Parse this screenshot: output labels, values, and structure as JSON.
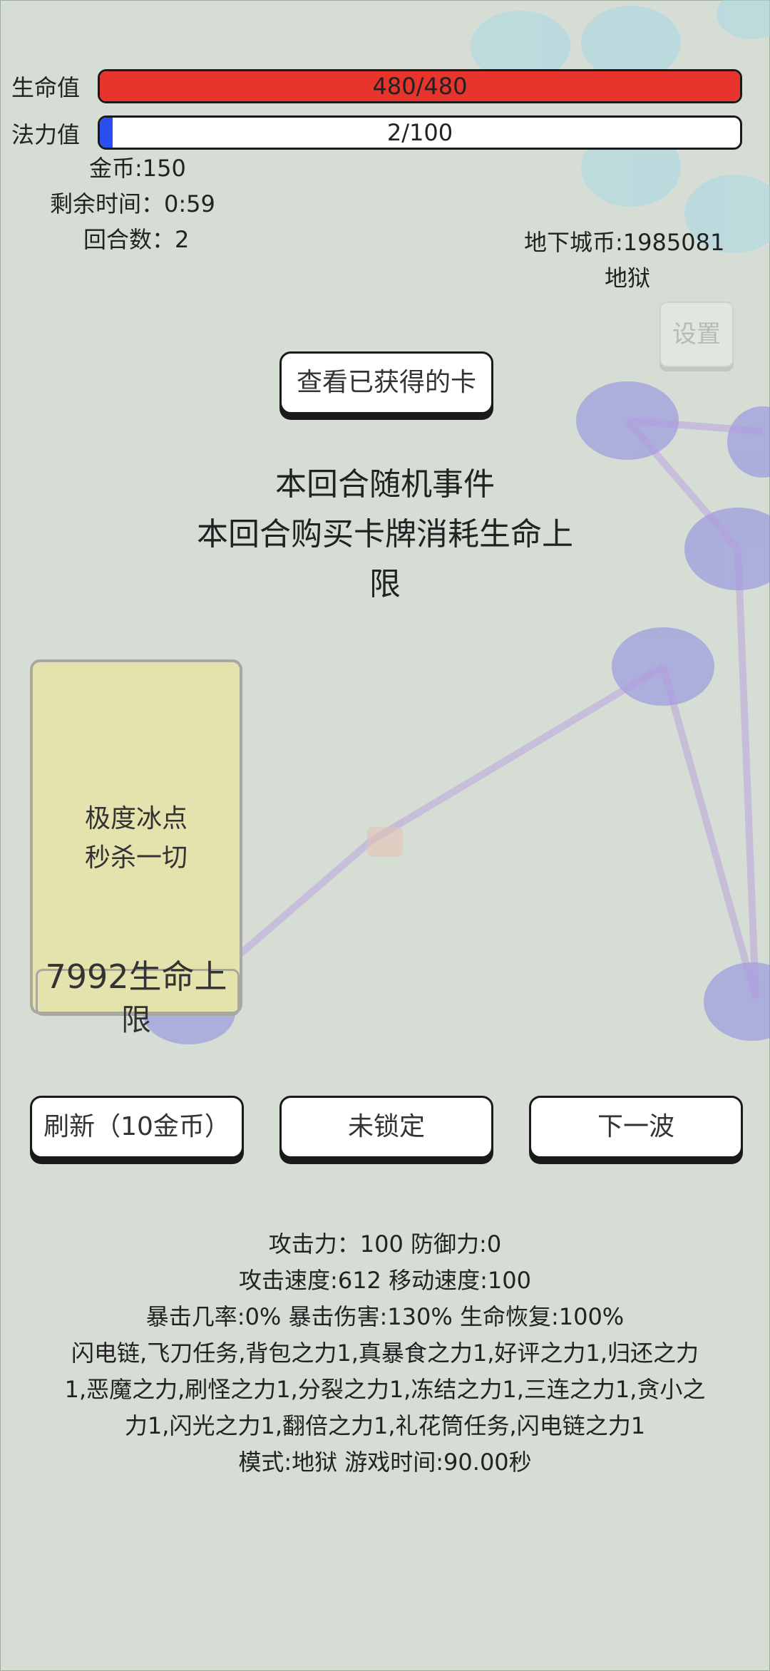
{
  "status": {
    "hp_label": "生命值",
    "hp_text": "480/480",
    "hp_fraction": 1.0,
    "hp_color": "#e8342c",
    "mp_label": "法力值",
    "mp_text": "2/100",
    "mp_fraction": 0.02,
    "mp_color": "#2a4ef0",
    "gold": "金币:150",
    "time_left": "剩余时间：0:59",
    "round": "回合数：2",
    "dungeon_coins": "地下城币:1985081",
    "difficulty": "地狱"
  },
  "settings_button": "设置",
  "view_cards_button": "查看已获得的卡",
  "event": {
    "title": "本回合随机事件",
    "line1": "本回合购买卡牌消耗生命上",
    "line2": "限"
  },
  "card": {
    "name": "极度冰点",
    "desc": "秒杀一切",
    "cost_line1": "7992生命上",
    "cost_line2": "限",
    "color": "#e4e2ad"
  },
  "buttons": {
    "refresh": "刷新（10金币）",
    "lock": "未锁定",
    "next_wave": "下一波"
  },
  "stats": {
    "line1": "攻击力：100 防御力:0",
    "line2": "攻击速度:612 移动速度:100",
    "line3": "暴击几率:0% 暴击伤害:130% 生命恢复:100%",
    "line4": "闪电链,飞刀任务,背包之力1,真暴食之力1,好评之力1,归还之力",
    "line5": "1,恶魔之力,刷怪之力1,分裂之力1,冻结之力1,三连之力1,贪小之",
    "line6": "力1,闪光之力1,翻倍之力1,礼花筒任务,闪电链之力1",
    "line7": "模式:地狱 游戏时间:90.00秒"
  }
}
